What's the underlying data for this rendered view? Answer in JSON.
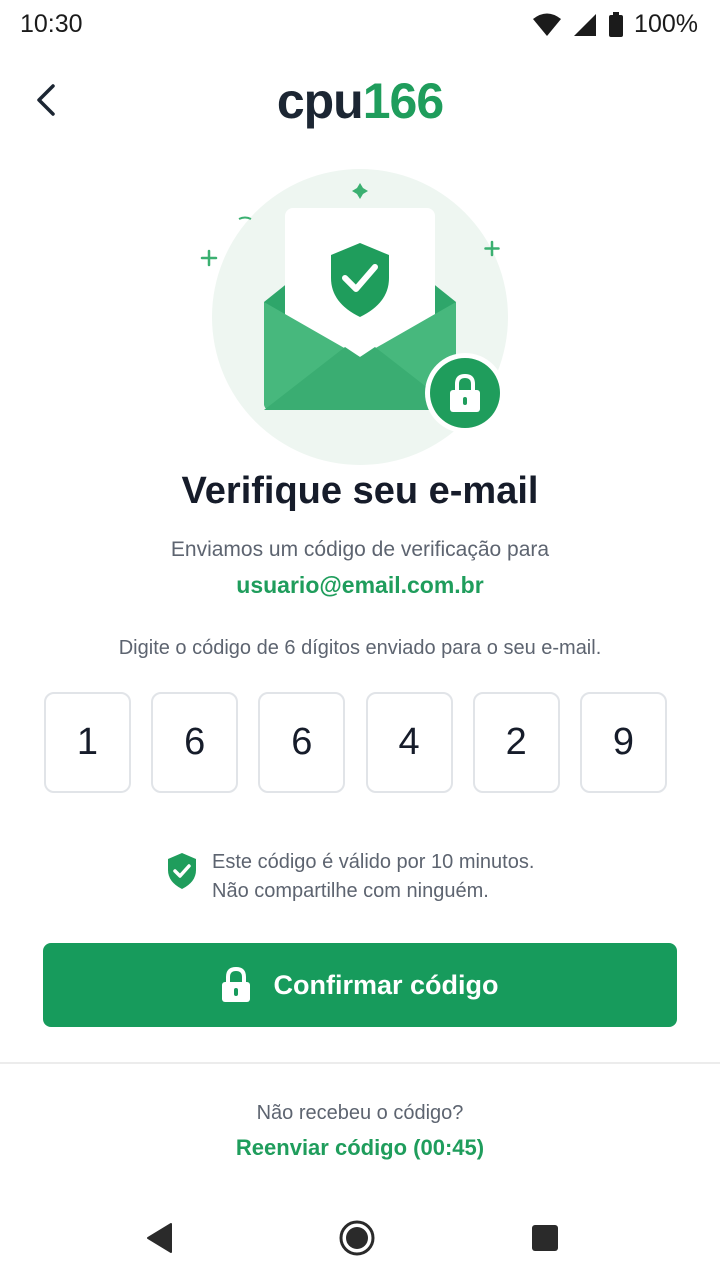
{
  "status_bar": {
    "time": "10:30",
    "battery": "100%",
    "icons": [
      "wifi-icon",
      "cell-signal-icon",
      "battery-icon"
    ]
  },
  "header": {
    "back_icon": "chevron-left-icon",
    "logo_part1": "cpu",
    "logo_part2": "166"
  },
  "hero": {
    "icons": [
      "envelope-icon",
      "shield-check-icon",
      "lock-icon",
      "sparkle-icon"
    ]
  },
  "main": {
    "title": "Verifique seu e-mail",
    "subtitle": "Enviamos um código de verificação para",
    "email": "usuario@email.com.br",
    "instruction": "Digite o código de 6 dígitos enviado para o seu e-mail.",
    "code_digits": [
      "1",
      "6",
      "6",
      "4",
      "2",
      "9"
    ],
    "notice_line1": "Este código é válido por 10 minutos.",
    "notice_line2": "Não compartilhe com ninguém.",
    "confirm_label": "Confirmar código"
  },
  "footer": {
    "resend_question": "Não recebeu o código?",
    "resend_link": "Reenviar código (00:45)"
  },
  "nav_bar": {
    "icons": [
      "back-triangle-icon",
      "home-circle-icon",
      "recents-square-icon"
    ]
  },
  "colors": {
    "accent": "#1f9d5c",
    "button": "#179b5c",
    "title": "#161c2a",
    "muted": "#5d6470"
  }
}
